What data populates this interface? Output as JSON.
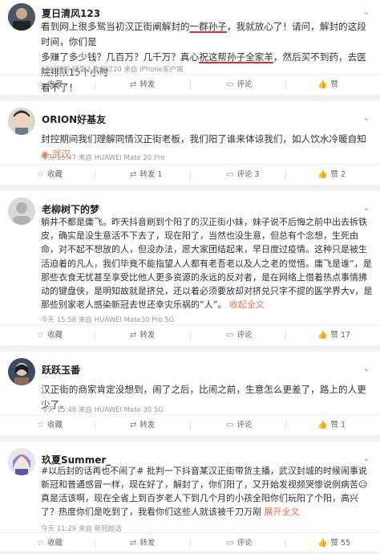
{
  "posts": [
    {
      "name": "夏日清风123",
      "lines": [
        [
          "看到网上很多鸳当初汉正街阐解封的",
          "一群孙子",
          "，我就放心了！请问，解封的这段时间，你们是"
        ],
        [
          "多赚了多少钱？几百万？几千万？真心",
          "祝这帮孙子全家羊",
          "，然后买不到药，去医院排队15个小时"
        ],
        [
          "看不了！",
          "",
          ""
        ]
      ],
      "meta": "12分钟前  转发人数超过20  来自 iPhone客户端",
      "actions": {
        "fav": "收藏",
        "repost": "转发",
        "comment": "评论",
        "like": "赞"
      }
    },
    {
      "name": "ORION好基友",
      "text": "封控期间我们理解同情汉正街老板，我们阳了谁来体谅我们，如人饮水冷暖自知",
      "loc": "武汉",
      "meta": "今天 15:47  来自 HUAWEI Mate 20 Pro",
      "actions": {
        "fav": "收藏",
        "repost": "转发 1",
        "comment": "评论 3",
        "like": "赞 2"
      }
    },
    {
      "name": "老柳树下的梦",
      "text": "躺井不都是庸飞。昨天抖音刷到个阳了的汉正街小妹，妹子说不后悔之前中出去拆铁皮，确实是没生意活不下去了，现在阳了，当然也没生意，但总有个念想，生死由命，对不起不想放的人，但没办法，愿大家团结起来，早日度过疫情。这种只是被生活迫着的凡人，我们毕竟不能指望人人都有老吾老以及人之老的觉悟。庸飞是谁”，是那些衣食无忧甚至享受比他人更多资源的永远的反对者，是在网络上借着热点事情拂动的键盘侠，是明知故就是挤兑，还以着必须要放却对挤兑只字不提的医学界大v，是那些别家老人感染新冠去世还幸灾乐祸的”人”。",
      "link": "收起全文",
      "meta": "今天 15:58  来自 HUAWEI Mate30 Pro 5G",
      "actions": {
        "fav": "收藏",
        "repost": "转发",
        "comment": "评论",
        "like": "赞 17"
      }
    },
    {
      "name": "跃跃玉番",
      "text": "汉正街的商家肯定没想到，闹了之后，比闹之前，生意怎么更差了，路上的人更少了。",
      "meta": "今天 15:48  来自 HUAWEI Mate 30 5G",
      "actions": {
        "fav": "收藏",
        "repost": "转发",
        "comment": "评论",
        "like": "赞 1"
      }
    },
    {
      "name": "玖夏Summer_",
      "text": "#以后封的话再也不闹了# 批判一下抖音某汉正街带货主播，武汉封城的时候闹事说新冠和普通感冒一样，现在好了，解封了，你们阳了，又开始发视频哭惨说例病苦😥 真是活该啊，现在全省上到百岁老人下到几个月的小孩全阳你们玩阳了个阳，高兴了？热度你们是吃到了，我看你们这些人就该被千刀万剐",
      "link": "展开全文",
      "meta": "今天 11:29  来自 新冠超话",
      "actions": {
        "fav": "收藏",
        "repost": "转发",
        "comment": "评论",
        "like": "赞 55"
      }
    }
  ]
}
